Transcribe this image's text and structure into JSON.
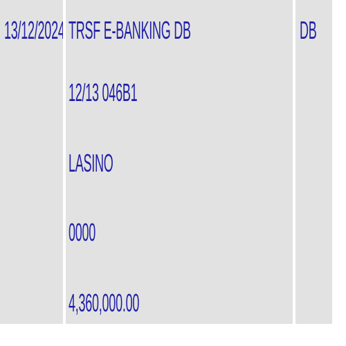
{
  "row": {
    "date": "13/12/2024",
    "description_lines": [
      "TRSF E-BANKING DB",
      "12/13 046B1",
      "LASINO",
      "0000",
      "4,360,000.00"
    ],
    "type": "DB"
  }
}
